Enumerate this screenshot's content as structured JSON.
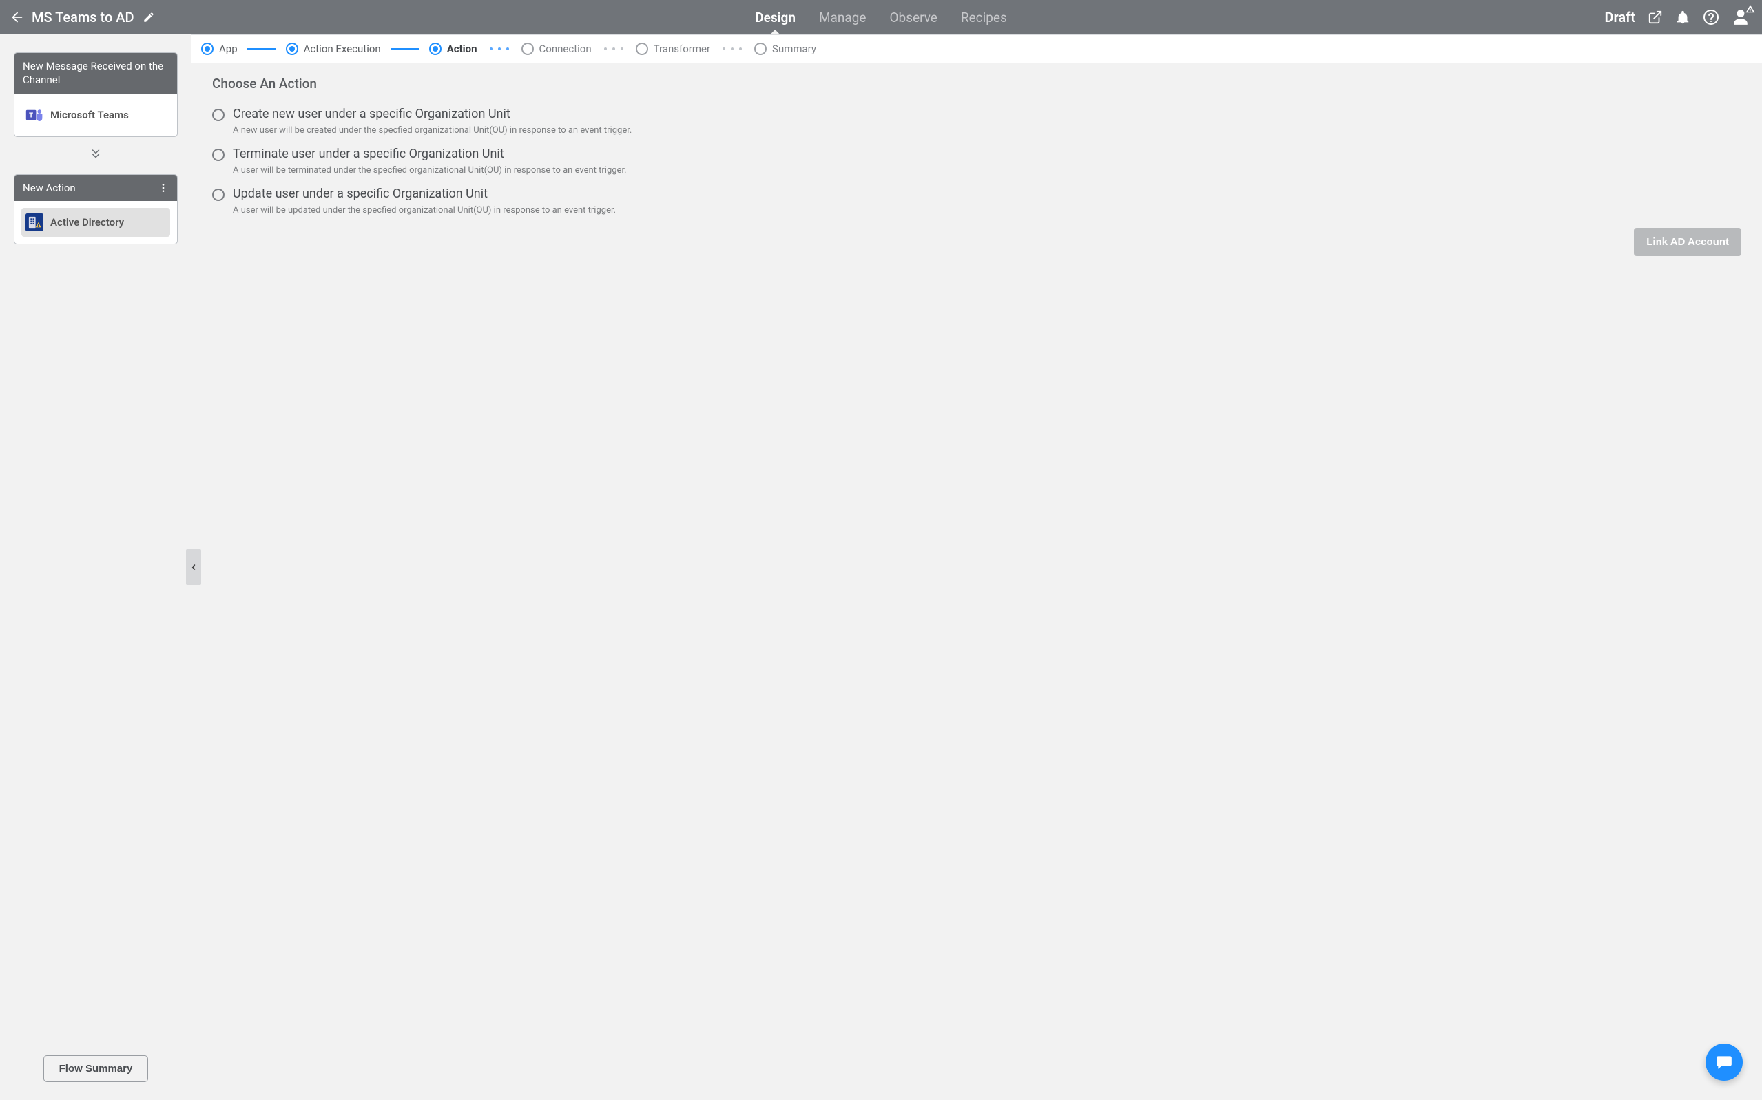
{
  "header": {
    "title": "MS Teams to AD",
    "tabs": [
      "Design",
      "Manage",
      "Observe",
      "Recipes"
    ],
    "active_tab": 0,
    "status": "Draft"
  },
  "sidebar": {
    "cards": [
      {
        "header": "New Message Received on the Channel",
        "app_label": "Microsoft Teams",
        "selected": false,
        "has_menu": false,
        "app_icon": "ms-teams"
      },
      {
        "header": "New Action",
        "app_label": "Active Directory",
        "selected": true,
        "has_menu": true,
        "app_icon": "active-directory"
      }
    ],
    "flow_summary_label": "Flow Summary"
  },
  "steps": [
    {
      "label": "App",
      "state": "done"
    },
    {
      "label": "Action Execution",
      "state": "done"
    },
    {
      "label": "Action",
      "state": "active"
    },
    {
      "label": "Connection",
      "state": "upcoming"
    },
    {
      "label": "Transformer",
      "state": "upcoming"
    },
    {
      "label": "Summary",
      "state": "upcoming"
    }
  ],
  "panel": {
    "title": "Choose An Action",
    "options": [
      {
        "title": "Create new user under a specific Organization Unit",
        "desc": "A new user will be created under the specfied organizational Unit(OU) in response to an event trigger."
      },
      {
        "title": "Terminate user under a specific Organization Unit",
        "desc": "A user will be terminated under the specfied organizational Unit(OU) in response to an event trigger."
      },
      {
        "title": "Update user under a specific Organization Unit",
        "desc": "A user will be updated under the specfied organizational Unit(OU) in response to an event trigger."
      }
    ],
    "link_button_label": "Link AD Account"
  },
  "colors": {
    "accent": "#1f8fff",
    "header_bg": "#707479",
    "card_header_bg": "#66696d"
  }
}
